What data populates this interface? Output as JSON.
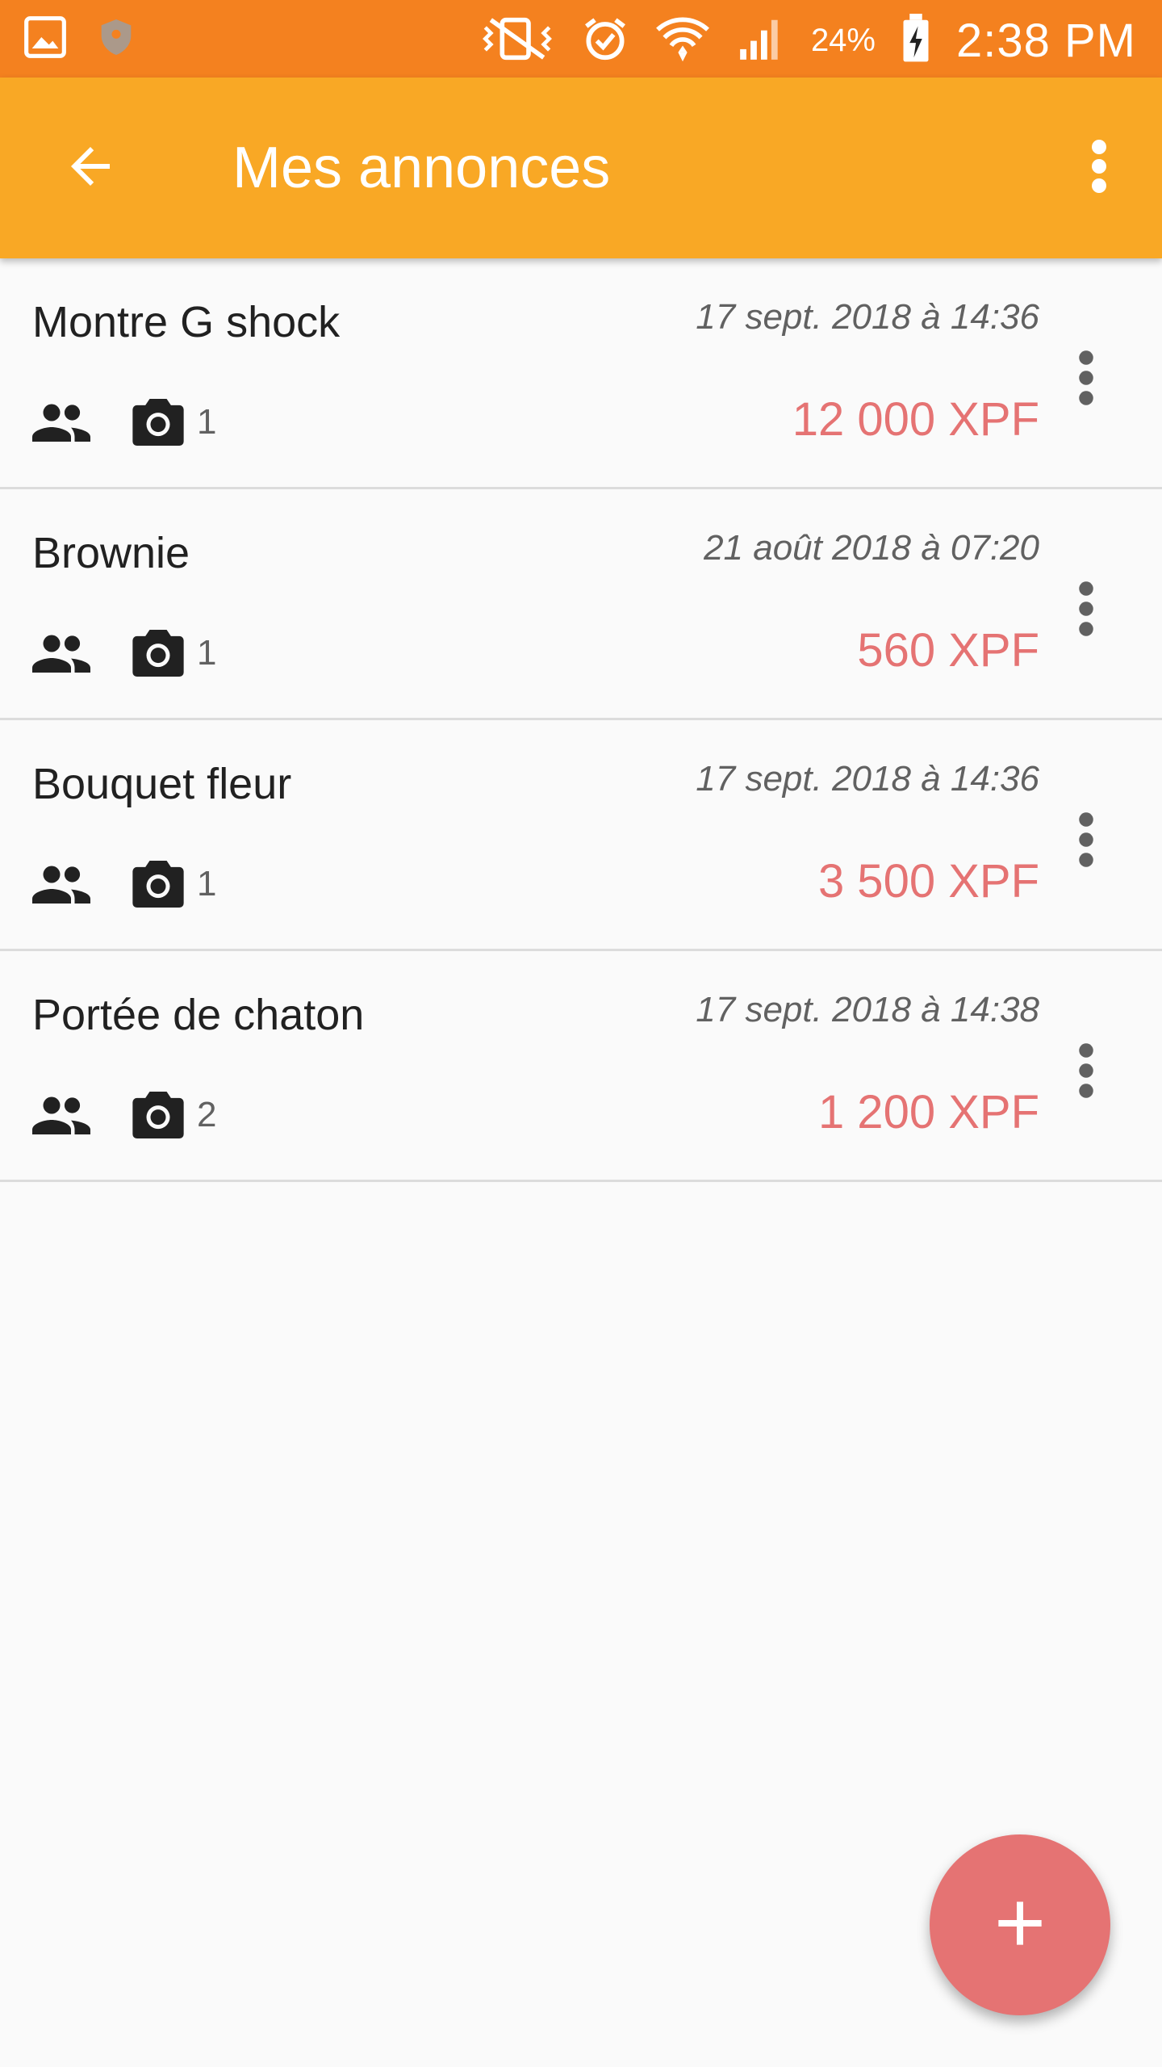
{
  "status_bar": {
    "battery_percent": "24%",
    "time": "2:38 PM",
    "icons": [
      "gallery-icon",
      "shield-icon",
      "vibrate-icon",
      "alarm-icon",
      "wifi-icon",
      "signal-icon",
      "battery-charging-icon"
    ]
  },
  "app_bar": {
    "title": "Mes annonces",
    "back_icon": "arrow-back-icon",
    "overflow_icon": "more-vert-icon"
  },
  "listings": [
    {
      "title": "Montre G shock",
      "date": "17 sept. 2018 à 14:36",
      "photo_count": "1",
      "price": "12 000 XPF"
    },
    {
      "title": "Brownie",
      "date": "21 août 2018 à 07:20",
      "photo_count": "1",
      "price": "560 XPF"
    },
    {
      "title": "Bouquet fleur",
      "date": "17 sept. 2018 à 14:36",
      "photo_count": "1",
      "price": "3 500 XPF"
    },
    {
      "title": "Portée de chaton",
      "date": "17 sept. 2018 à 14:38",
      "photo_count": "2",
      "price": "1 200 XPF"
    }
  ],
  "fab": {
    "icon": "add-icon"
  },
  "colors": {
    "status_bar": "#f4811f",
    "app_bar": "#f9a825",
    "price": "#e57373",
    "fab": "#e57373"
  }
}
